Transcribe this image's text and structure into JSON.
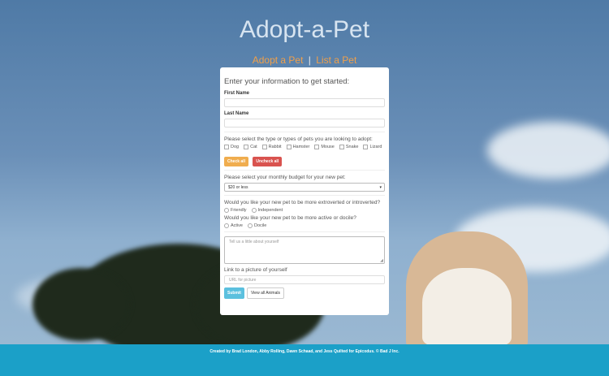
{
  "site": {
    "title": "Adopt-a-Pet"
  },
  "nav": {
    "adopt_label": "Adopt a Pet",
    "separator": "|",
    "list_label": "List a Pet"
  },
  "form": {
    "intro": "Enter your information to get started:",
    "first_name_label": "First Name",
    "last_name_label": "Last Name",
    "pet_types_question": "Please select the type or types of pets you are looking to adopt:",
    "pet_types": [
      "Dog",
      "Cat",
      "Rabbit",
      "Hamster",
      "Mouse",
      "Snake",
      "Lizard"
    ],
    "check_all_label": "Check all",
    "uncheck_all_label": "Uncheck all",
    "budget_question": "Please select your monthly budget for your new pet:",
    "budget_selected": "$20 or less",
    "personality_question": "Would you like your new pet to be more extroverted or introverted?",
    "personality_options": [
      "Friendly",
      "Independent"
    ],
    "activity_question": "Would you like your new pet to be more active or docile?",
    "activity_options": [
      "Active",
      "Docile"
    ],
    "about_placeholder": "Tell us a little about yourself",
    "picture_label": "Link to a picture of yourself",
    "picture_placeholder": "URL for picture",
    "submit_label": "Submit",
    "view_all_label": "View all Animals"
  },
  "footer": {
    "text": "Created by Brad London, Abby Rolling, Dawn Schaad, and Jess Quilted for Epicodus. © Bad J Inc."
  },
  "colors": {
    "accent": "#f0a04a",
    "footer": "#1ba0c8",
    "check_all": "#f0ad4e",
    "uncheck_all": "#d9534f",
    "submit": "#5bc0de"
  }
}
